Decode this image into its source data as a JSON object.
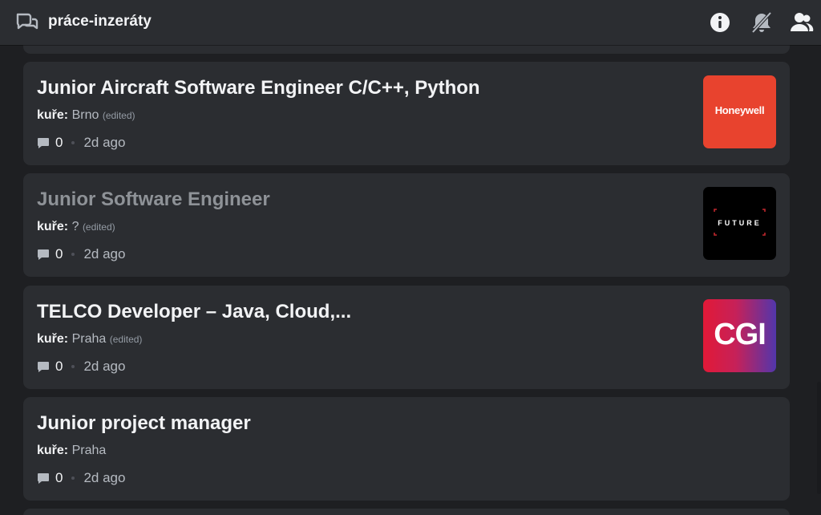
{
  "header": {
    "channel_name": "práce-inzeráty",
    "icons": [
      "forum-icon",
      "info-icon",
      "bell-muted-icon",
      "member-list-icon"
    ]
  },
  "posts": [
    {
      "title": "Junior Aircraft Software Engineer C/C++, Python",
      "author": "kuře:",
      "location": "Brno",
      "edited": "(edited)",
      "comments": "0",
      "time": "2d ago",
      "logo": "Honeywell"
    },
    {
      "title": "Junior Software Engineer",
      "author": "kuře:",
      "location": "?",
      "edited": "(edited)",
      "comments": "0",
      "time": "2d ago",
      "logo": "FUTURE"
    },
    {
      "title": "TELCO Developer – Java, Cloud,...",
      "author": "kuře:",
      "location": "Praha",
      "edited": "(edited)",
      "comments": "0",
      "time": "2d ago",
      "logo": "CGI"
    },
    {
      "title": "Junior project manager",
      "author": "kuře:",
      "location": "Praha",
      "comments": "0",
      "time": "2d ago"
    }
  ],
  "colors": {
    "background": "#1e1f22",
    "card": "#2b2d31",
    "honeywell": "#e8432e",
    "cgi_start": "#e11937",
    "cgi_end": "#5236ab"
  }
}
